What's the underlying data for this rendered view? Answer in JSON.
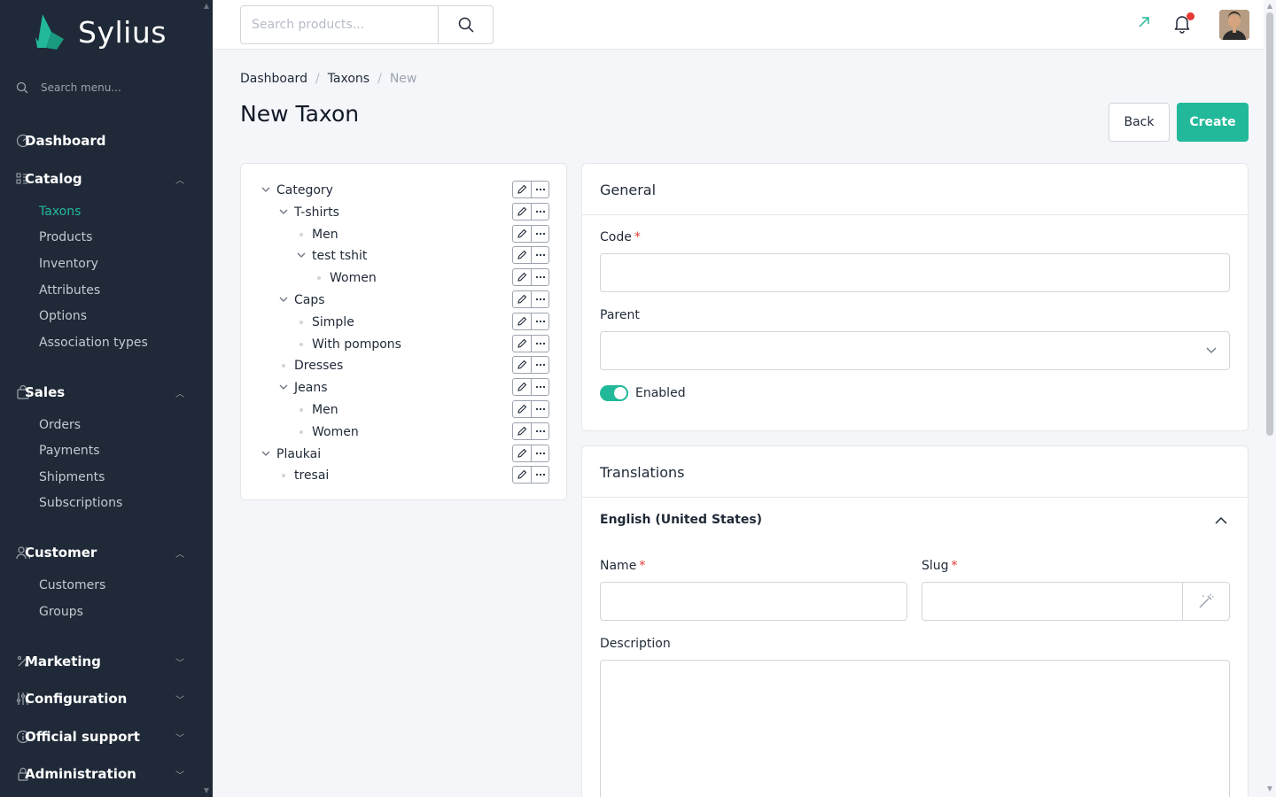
{
  "brand": {
    "name": "Sylius"
  },
  "sidebar": {
    "search_placeholder": "Search menu...",
    "dashboard": "Dashboard",
    "catalog": {
      "label": "Catalog",
      "items": [
        "Taxons",
        "Products",
        "Inventory",
        "Attributes",
        "Options",
        "Association types"
      ]
    },
    "sales": {
      "label": "Sales",
      "items": [
        "Orders",
        "Payments",
        "Shipments",
        "Subscriptions"
      ]
    },
    "customer": {
      "label": "Customer",
      "items": [
        "Customers",
        "Groups"
      ]
    },
    "marketing": "Marketing",
    "configuration": "Configuration",
    "official_support": "Official support",
    "administration": "Administration"
  },
  "topbar": {
    "search_placeholder": "Search products..."
  },
  "breadcrumb": {
    "dashboard": "Dashboard",
    "taxons": "Taxons",
    "current": "New"
  },
  "page": {
    "title": "New Taxon",
    "back_label": "Back",
    "create_label": "Create"
  },
  "tree": [
    {
      "label": "Category",
      "level": 0,
      "expandable": true
    },
    {
      "label": "T-shirts",
      "level": 1,
      "expandable": true
    },
    {
      "label": "Men",
      "level": 2,
      "expandable": false
    },
    {
      "label": "test tshit",
      "level": 2,
      "expandable": true
    },
    {
      "label": "Women",
      "level": 3,
      "expandable": false
    },
    {
      "label": "Caps",
      "level": 1,
      "expandable": true
    },
    {
      "label": "Simple",
      "level": 2,
      "expandable": false
    },
    {
      "label": "With pompons",
      "level": 2,
      "expandable": false
    },
    {
      "label": "Dresses",
      "level": 1,
      "expandable": false
    },
    {
      "label": "Jeans",
      "level": 1,
      "expandable": true
    },
    {
      "label": "Men",
      "level": 2,
      "expandable": false
    },
    {
      "label": "Women",
      "level": 2,
      "expandable": false
    },
    {
      "label": "Plaukai",
      "level": 0,
      "expandable": true
    },
    {
      "label": "tresai",
      "level": 1,
      "expandable": false
    }
  ],
  "general": {
    "title": "General",
    "code_label": "Code",
    "code_value": "",
    "parent_label": "Parent",
    "parent_value": "",
    "enabled_label": "Enabled",
    "enabled": true
  },
  "translations": {
    "title": "Translations",
    "locale": "English (United States)",
    "name_label": "Name",
    "name_value": "",
    "slug_label": "Slug",
    "slug_value": "",
    "description_label": "Description",
    "description_value": ""
  },
  "colors": {
    "accent": "#22b99a",
    "sidebar_bg": "#1f2937",
    "notification": "#e53935"
  }
}
